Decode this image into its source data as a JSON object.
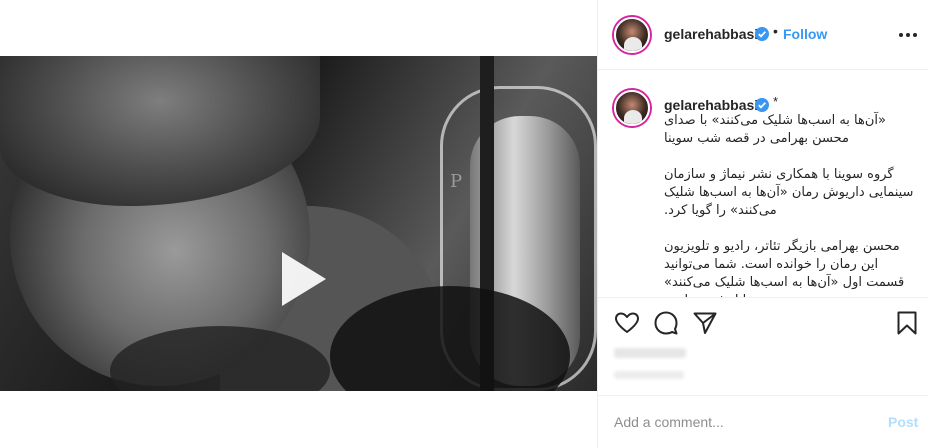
{
  "header": {
    "username": "gelarehabbasi",
    "separator": "•",
    "follow_label": "Follow"
  },
  "caption": {
    "username": "gelarehabbasi",
    "marker": "*",
    "paragraphs": [
      "«آن‌ها به اسب‌ها شلیک می‌کنند» با صدای محسن بهرامی در قصه شب سوینا",
      "گروه سوینا با همکاری نشر نیماژ و سازمان سینمایی داریوش رمان «آن‌ها به اسب‌ها شلیک می‌کنند» را گویا کرد.",
      "محسن بهرامی بازیگر تئاتر، رادیو و تلویزیون این رمان را خوانده است. شما می‌توانید قسمت اول «آن‌ها به اسب‌ها شلیک می‌کنند» را امشب ساعت"
    ]
  },
  "video": {
    "watermark": "P"
  },
  "actions": {
    "icons": [
      "heart-icon",
      "comment-icon",
      "share-icon",
      "bookmark-icon"
    ]
  },
  "comment": {
    "placeholder": "Add a comment...",
    "post_label": "Post"
  },
  "colors": {
    "accent": "#3897f0",
    "verified": "#3897f0",
    "post_disabled": "#b2dffc",
    "text": "#262626",
    "muted": "#8e8e8e",
    "border": "#efefef"
  }
}
